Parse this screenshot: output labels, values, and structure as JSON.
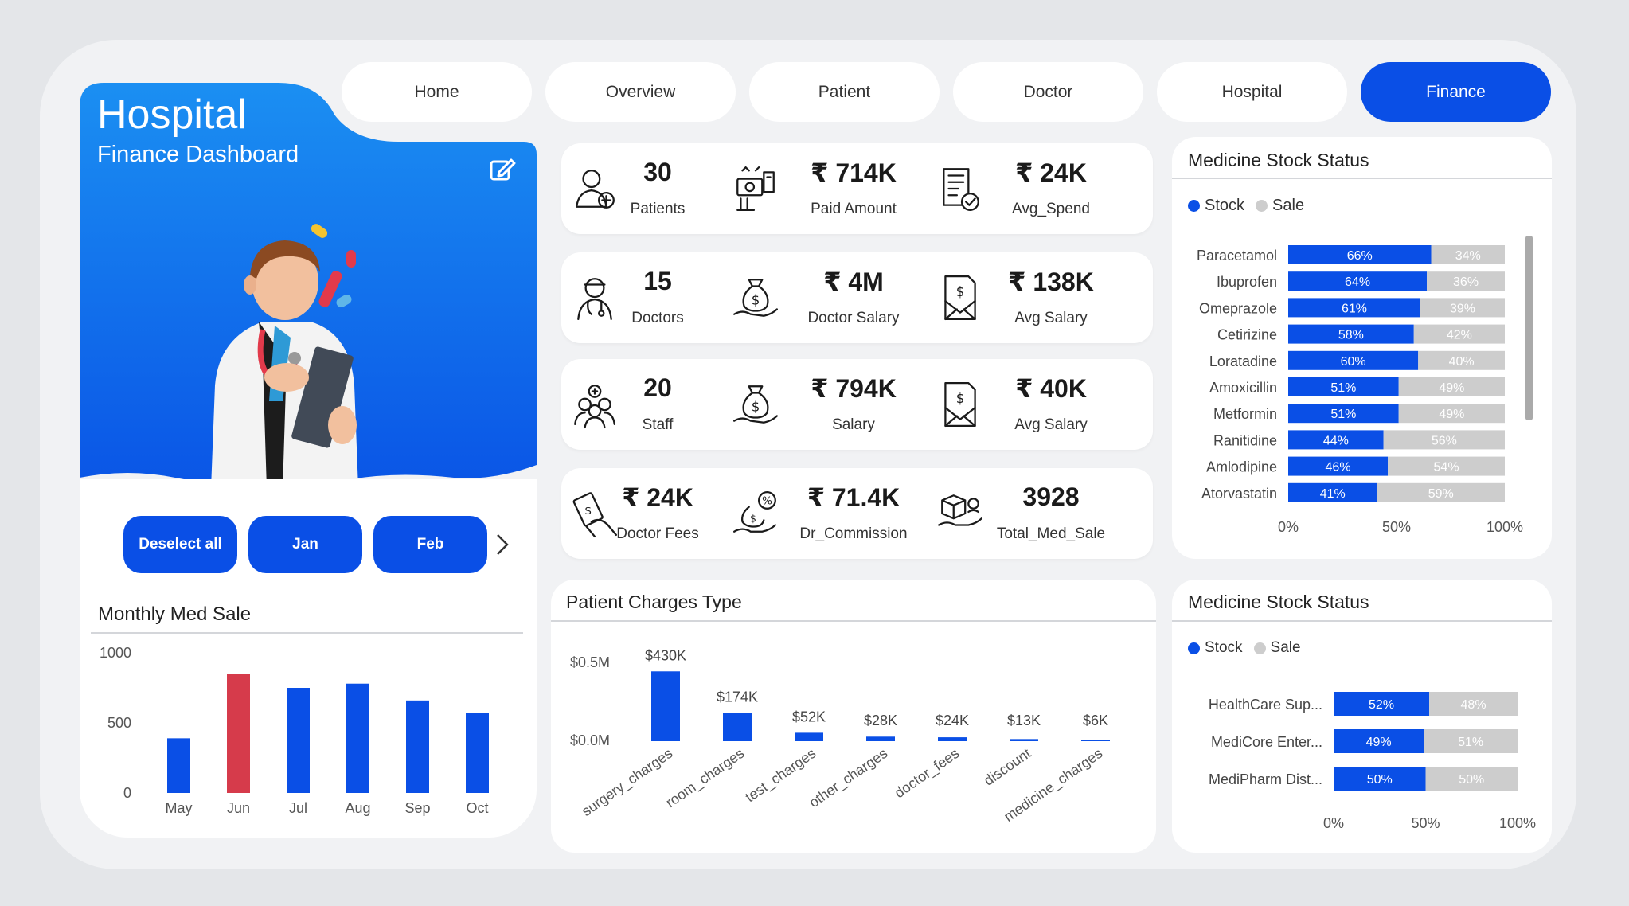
{
  "nav": {
    "tabs": [
      {
        "label": "Home"
      },
      {
        "label": "Overview"
      },
      {
        "label": "Patient"
      },
      {
        "label": "Doctor"
      },
      {
        "label": "Hospital"
      },
      {
        "label": "Finance"
      }
    ],
    "active": "Finance"
  },
  "hero": {
    "title": "Hospital",
    "subtitle": "Finance Dashboard",
    "edit_icon": "edit-icon",
    "illustration": "doctor-with-clipboard"
  },
  "slicer": {
    "buttons": [
      {
        "label": "Deselect all"
      },
      {
        "label": "Jan"
      },
      {
        "label": "Feb"
      }
    ],
    "next_icon": "chevron-right-icon"
  },
  "kpis": [
    [
      {
        "value": "30",
        "label": "Patients",
        "icon": "patient-icon"
      },
      {
        "value": "₹ 714K",
        "label": "Paid Amount",
        "icon": "payment-icon"
      },
      {
        "value": "₹ 24K",
        "label": "Avg_Spend",
        "icon": "invoice-icon"
      }
    ],
    [
      {
        "value": "15",
        "label": "Doctors",
        "icon": "doctor-icon"
      },
      {
        "value": "₹ 4M",
        "label": "Doctor Salary",
        "icon": "money-bag-icon"
      },
      {
        "value": "₹ 138K",
        "label": "Avg Salary",
        "icon": "salary-envelope-icon"
      }
    ],
    [
      {
        "value": "20",
        "label": "Staff",
        "icon": "staff-icon"
      },
      {
        "value": "₹ 794K",
        "label": "Salary",
        "icon": "money-bag-icon"
      },
      {
        "value": "₹ 40K",
        "label": "Avg Salary",
        "icon": "salary-envelope-icon"
      }
    ],
    [
      {
        "value": "₹ 24K",
        "label": "Doctor Fees",
        "icon": "cash-hand-icon"
      },
      {
        "value": "₹ 71.4K",
        "label": "Dr_Commission",
        "icon": "commission-icon"
      },
      {
        "value": "3928",
        "label": "Total_Med_Sale",
        "icon": "medicine-delivery-icon"
      }
    ]
  ],
  "colors": {
    "primary": "#0a4fe6",
    "highlight": "#d63b4b",
    "sale_gray": "#cdcdcd",
    "panel": "#ffffff",
    "frame": "#f1f2f4"
  },
  "monthly_med_sale": {
    "title": "Monthly Med Sale",
    "chart_data": {
      "type": "bar",
      "categories": [
        "May",
        "Jun",
        "Jul",
        "Aug",
        "Sep",
        "Oct"
      ],
      "values": [
        390,
        850,
        750,
        780,
        660,
        570
      ],
      "highlight_index": 1,
      "yticks": [
        "1000",
        "500",
        "0"
      ],
      "ylim": [
        0,
        1000
      ],
      "grid": false
    }
  },
  "patient_charges": {
    "title": "Patient Charges Type",
    "chart_data": {
      "type": "bar",
      "categories": [
        "surgery_charges",
        "room_charges",
        "test_charges",
        "other_charges",
        "doctor_fees",
        "discount",
        "medicine_charges"
      ],
      "values": [
        430,
        174,
        52,
        28,
        24,
        13,
        6
      ],
      "value_units": "$K",
      "data_labels": [
        "$430K",
        "$174K",
        "$52K",
        "$28K",
        "$24K",
        "$13K",
        "$6K"
      ],
      "yticks": [
        "$0.5M",
        "$0.0M"
      ],
      "ylim": [
        0,
        500
      ],
      "grid": false
    }
  },
  "stock_status_1": {
    "title": "Medicine Stock Status",
    "legend": [
      "Stock",
      "Sale"
    ],
    "chart_data": {
      "type": "bar",
      "orientation": "horizontal-stacked-100",
      "categories": [
        "Paracetamol",
        "Ibuprofen",
        "Omeprazole",
        "Cetirizine",
        "Loratadine",
        "Amoxicillin",
        "Metformin",
        "Ranitidine",
        "Amlodipine",
        "Atorvastatin"
      ],
      "series": [
        {
          "name": "Stock",
          "values": [
            66,
            64,
            61,
            58,
            60,
            51,
            51,
            44,
            46,
            41
          ]
        },
        {
          "name": "Sale",
          "values": [
            34,
            36,
            39,
            42,
            40,
            49,
            49,
            56,
            54,
            59
          ]
        }
      ],
      "xticks": [
        "0%",
        "50%",
        "100%"
      ],
      "legend_position": "top-left"
    }
  },
  "stock_status_2": {
    "title": "Medicine Stock Status",
    "legend": [
      "Stock",
      "Sale"
    ],
    "chart_data": {
      "type": "bar",
      "orientation": "horizontal-stacked-100",
      "categories": [
        "HealthCare Sup...",
        "MediCore Enter...",
        "MediPharm Dist..."
      ],
      "series": [
        {
          "name": "Stock",
          "values": [
            52,
            49,
            50
          ]
        },
        {
          "name": "Sale",
          "values": [
            48,
            51,
            50
          ]
        }
      ],
      "xticks": [
        "0%",
        "50%",
        "100%"
      ],
      "legend_position": "top-left"
    }
  }
}
